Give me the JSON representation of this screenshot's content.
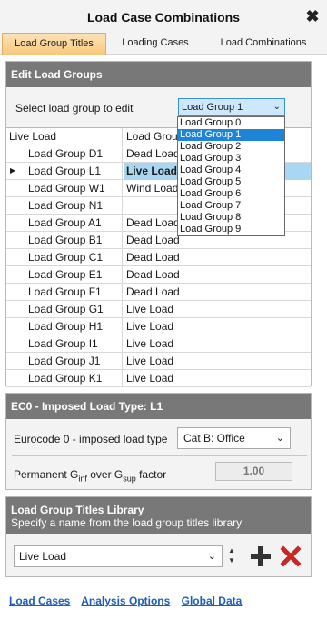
{
  "window": {
    "title": "Load Case Combinations",
    "close_glyph": "✖"
  },
  "tabs": [
    {
      "label": "Load Group Titles",
      "active": true
    },
    {
      "label": "Loading Cases",
      "active": false
    },
    {
      "label": "Load Combinations",
      "active": false
    }
  ],
  "edit_groups": {
    "header": "Edit Load Groups",
    "select_label": "Select load group to edit",
    "selected": "Load Group 1",
    "options": [
      "Load Group 0",
      "Load Group 1",
      "Load Group 2",
      "Load Group 3",
      "Load Group 4",
      "Load Group 5",
      "Load Group 6",
      "Load Group 7",
      "Load Group 8",
      "Load Group 9"
    ],
    "grid": {
      "columns": [
        "Live Load",
        "Load Group"
      ],
      "rows": [
        {
          "name": "Load Group D1",
          "value": "Dead Load"
        },
        {
          "name": "Load Group L1",
          "value": "Live Load",
          "current": true
        },
        {
          "name": "Load Group W1",
          "value": "Wind Load"
        },
        {
          "name": "Load Group N1",
          "value": ""
        },
        {
          "name": "Load Group A1",
          "value": "Dead Load"
        },
        {
          "name": "Load Group B1",
          "value": "Dead Load"
        },
        {
          "name": "Load Group C1",
          "value": "Dead Load"
        },
        {
          "name": "Load Group E1",
          "value": "Dead Load"
        },
        {
          "name": "Load Group F1",
          "value": "Dead Load"
        },
        {
          "name": "Load Group G1",
          "value": "Live Load"
        },
        {
          "name": "Load Group H1",
          "value": "Live Load"
        },
        {
          "name": "Load Group I1",
          "value": "Live Load"
        },
        {
          "name": "Load Group J1",
          "value": "Live Load"
        },
        {
          "name": "Load Group K1",
          "value": "Live Load"
        }
      ]
    }
  },
  "imposed": {
    "header": "EC0 - Imposed Load Type: L1",
    "type_label": "Eurocode 0 - imposed load type",
    "type_value": "Cat B: Office",
    "perm_label_a": "Permanent G",
    "perm_sub_a": "inf",
    "perm_label_b": " over G",
    "perm_sub_b": "sup",
    "perm_label_c": " factor",
    "factor_value": "1.00"
  },
  "library": {
    "header": "Load Group Titles Library",
    "subheader": "Specify a name from the load group titles library",
    "value": "Live Load"
  },
  "links": [
    "Load Cases",
    "Analysis Options",
    "Global Data"
  ],
  "colors": {
    "accent_blue": "#1e84d8",
    "delete_red": "#c62828",
    "add_dark": "#333333"
  }
}
